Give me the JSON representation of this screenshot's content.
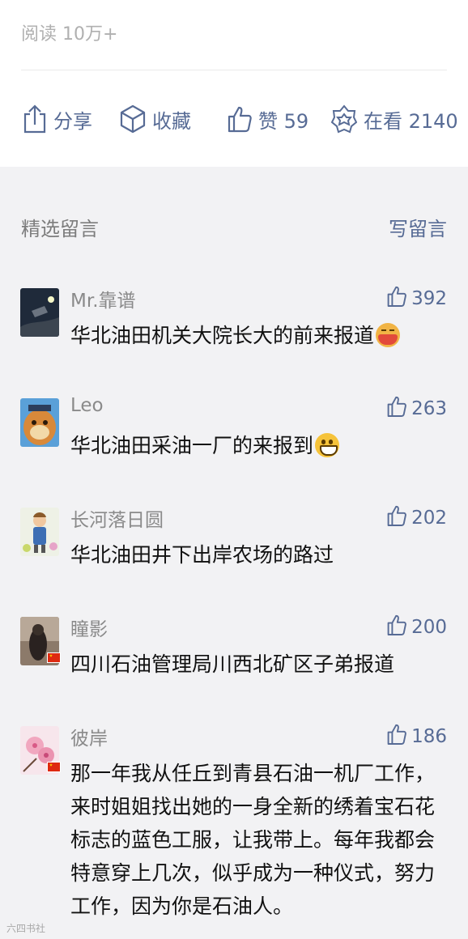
{
  "article": {
    "read_count": "阅读 10万+"
  },
  "actions": {
    "share_label": "分享",
    "favorite_label": "收藏",
    "like_label": "赞 59",
    "watching_label": "在看 2140"
  },
  "comments_section": {
    "title": "精选留言",
    "write_label": "写留言"
  },
  "comments": [
    {
      "name": "Mr.靠谱",
      "likes": "392",
      "text": "华北油田机关大院长大的前来报道",
      "emoji": "sick-face"
    },
    {
      "name": "Leo",
      "likes": "263",
      "text": "华北油田采油一厂的来报到",
      "emoji": "grin-face"
    },
    {
      "name": "长河落日圆",
      "likes": "202",
      "text": "华北油田井下出岸农场的路过"
    },
    {
      "name": "瞳影",
      "likes": "200",
      "text": "四川石油管理局川西北矿区子弟报道"
    },
    {
      "name": "彼岸",
      "likes": "186",
      "text": "那一年我从任丘到青县石油一机厂工作，来时姐姐找出她的一身全新的绣着宝石花标志的蓝色工服，让我带上。每年我都会特意穿上几次，似乎成为一种仪式，努力工作，因为你是石油人。"
    }
  ],
  "watermark": "六四书社",
  "colors": {
    "link": "#576b95",
    "page_background": "#f2f2f4",
    "text": "#111111",
    "muted": "#8a8a8a"
  }
}
